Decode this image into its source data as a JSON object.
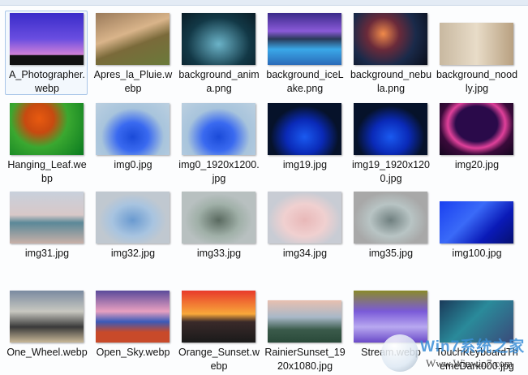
{
  "files": [
    {
      "name": "A_Photographer.webp",
      "bg": "linear-gradient(180deg,#3a2cc9 0%,#6a4ee0 50%,#d080d8 80%,#111 82%)",
      "selected": true
    },
    {
      "name": "Apres_la_Pluie.webp",
      "bg": "linear-gradient(160deg,#9a7a5a,#d9b48a 40%,#7a6a3a 60%,#6a7a3a)"
    },
    {
      "name": "background_anima.png",
      "bg": "radial-gradient(ellipse at 50% 60%,#6bb3c8,#123846 60%,#0a1c26)"
    },
    {
      "name": "background_iceLake.png",
      "bg": "linear-gradient(180deg,#3a2a8a,#8a5ad8 35%,#2a3a5a 50%,#3aa8e8 70%,#2a6ab8)"
    },
    {
      "name": "background_nebula.png",
      "bg": "radial-gradient(circle at 40% 40%,#f08a4a,#6a2a3a 30%,#1a2a4a 60%,#0a0e1a)"
    },
    {
      "name": "background_noodly.jpg",
      "bg": "linear-gradient(90deg,#c8b8a0,#e8dcc8 50%,#b8a080)",
      "short": true
    },
    {
      "name": "Hanging_Leaf.webp",
      "bg": "radial-gradient(circle at 40% 30%,#e85a10,#c84a10 25%,#3aa830 50%,#0a7a20)"
    },
    {
      "name": "img0.jpg",
      "bg": "radial-gradient(ellipse at 50% 65%,#1a4ad8,#3a6af0 30%,#a8c4dc 60%,#bcd0e0)"
    },
    {
      "name": "img0_1920x1200.jpg",
      "bg": "radial-gradient(ellipse at 50% 65%,#1a4ad8,#3a6af0 30%,#a8c4dc 60%,#bcd0e0)"
    },
    {
      "name": "img19.jpg",
      "bg": "radial-gradient(ellipse at 50% 65%,#1a5af0,#0a2ab8 35%,#06122a 65%)"
    },
    {
      "name": "img19_1920x1200.jpg",
      "bg": "radial-gradient(ellipse at 50% 65%,#1a5af0,#0a2ab8 35%,#06122a 65%)"
    },
    {
      "name": "img20.jpg",
      "bg": "radial-gradient(ellipse at 50% 40%,#2a0a4a 40%,#e0409a 55%,#3a0a3a 70%,#12061e)"
    },
    {
      "name": "img31.jpg",
      "bg": "linear-gradient(180deg,#c8d0dc,#d8c8c8 45%,#5a8898 60%,#c8b0a8)"
    },
    {
      "name": "img32.jpg",
      "bg": "radial-gradient(ellipse at 50% 55%,#6a9ad0,#a8c4e0 40%,#c0c8d0 65%)"
    },
    {
      "name": "img33.jpg",
      "bg": "radial-gradient(ellipse at 50% 55%,#5a6a60,#a0b0a8 40%,#b8c0c0 65%)"
    },
    {
      "name": "img34.jpg",
      "bg": "radial-gradient(ellipse at 50% 55%,#e8b8b8,#f0d0d0 40%,#c8ccd4 70%)"
    },
    {
      "name": "img35.jpg",
      "bg": "radial-gradient(ellipse at 50% 55%,#708080,#b8c4c4 40%,#a8a8a8 70%)"
    },
    {
      "name": "img100.jpg",
      "bg": "linear-gradient(135deg,#1a40f0,#3a6af8 40%,#0a1ab8 70%,#061070)",
      "short": true
    },
    {
      "name": "One_Wheel.webp",
      "bg": "linear-gradient(180deg,#7a8aa0,#c8c8c0 40%,#3a3a3a 70%,#c8b898)"
    },
    {
      "name": "Open_Sky.webp",
      "bg": "linear-gradient(180deg,#5a4a9a,#e8a0c0 40%,#3a5ab8 60%,#c84a2a 80%)"
    },
    {
      "name": "Orange_Sunset.webp",
      "bg": "linear-gradient(180deg,#e83a2a,#f8a83a 45%,#3a2a2a 60%,#1a1a1a)"
    },
    {
      "name": "RainierSunset_1920x1080.jpg",
      "bg": "linear-gradient(180deg,#e8c0b0,#a8b8c8 40%,#3a5a4a 70%,#2a4a3a)",
      "short": true
    },
    {
      "name": "Stream.webp",
      "bg": "linear-gradient(180deg,#8a8a2a,#7a5ad8 40%,#b8a8f0 70%,#6a4ac8)"
    },
    {
      "name": "TouchKeyboardThemeDark000.jpg",
      "bg": "linear-gradient(135deg,#1a3a5a,#2a8a9a 45%,#3a4a7a)",
      "short": true
    }
  ],
  "watermark": {
    "brand": "Win7系统之家",
    "url": "Www.Winwin7.com"
  }
}
